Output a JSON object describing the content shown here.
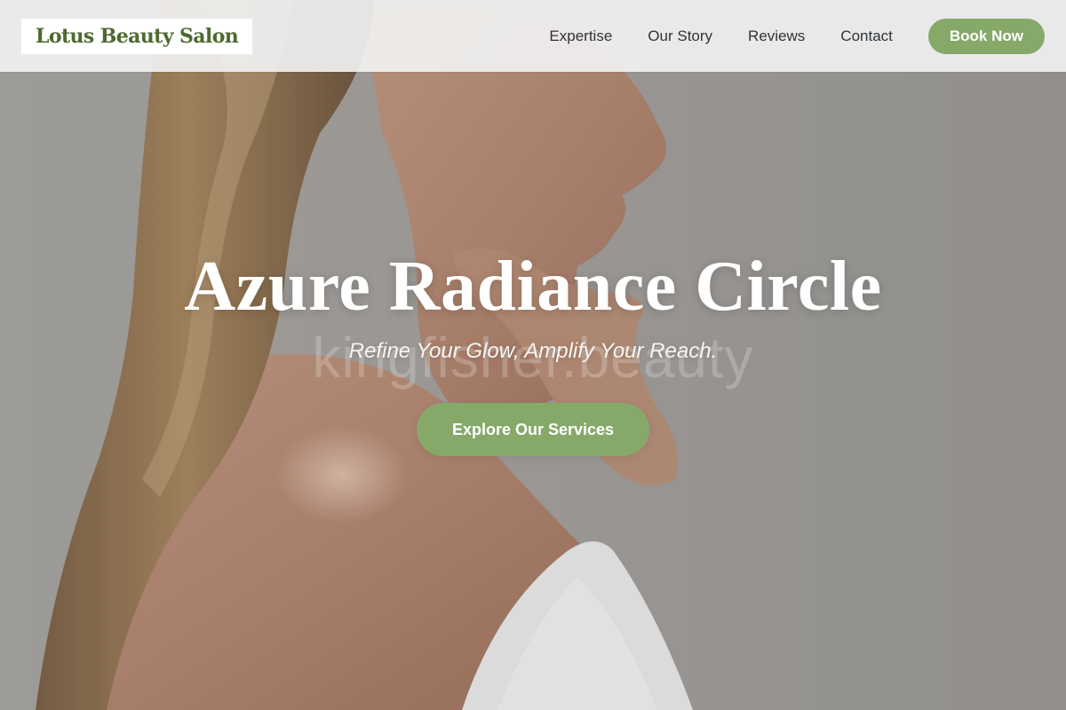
{
  "brand": {
    "name": "Lotus Beauty Salon",
    "color": "#4d6a30"
  },
  "nav": {
    "links": [
      "Expertise",
      "Our Story",
      "Reviews",
      "Contact"
    ],
    "cta_label": "Book Now"
  },
  "hero": {
    "title": "Azure Radiance Circle",
    "tagline": "Refine Your Glow, Amplify Your Reach.",
    "watermark": "kingfisher.beauty",
    "cta_label": "Explore Our Services",
    "background": "photo of a woman in profile wearing a white towel",
    "accent_color": "#86a96a"
  }
}
